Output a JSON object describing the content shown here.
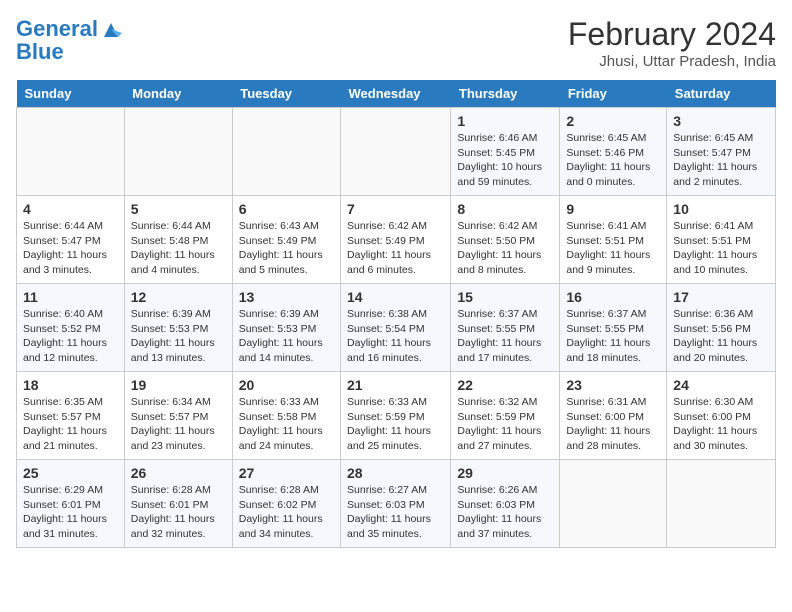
{
  "header": {
    "logo_line1": "General",
    "logo_line2": "Blue",
    "title": "February 2024",
    "subtitle": "Jhusi, Uttar Pradesh, India"
  },
  "weekdays": [
    "Sunday",
    "Monday",
    "Tuesday",
    "Wednesday",
    "Thursday",
    "Friday",
    "Saturday"
  ],
  "weeks": [
    [
      {
        "day": "",
        "info": ""
      },
      {
        "day": "",
        "info": ""
      },
      {
        "day": "",
        "info": ""
      },
      {
        "day": "",
        "info": ""
      },
      {
        "day": "1",
        "info": "Sunrise: 6:46 AM\nSunset: 5:45 PM\nDaylight: 10 hours and 59 minutes."
      },
      {
        "day": "2",
        "info": "Sunrise: 6:45 AM\nSunset: 5:46 PM\nDaylight: 11 hours and 0 minutes."
      },
      {
        "day": "3",
        "info": "Sunrise: 6:45 AM\nSunset: 5:47 PM\nDaylight: 11 hours and 2 minutes."
      }
    ],
    [
      {
        "day": "4",
        "info": "Sunrise: 6:44 AM\nSunset: 5:47 PM\nDaylight: 11 hours and 3 minutes."
      },
      {
        "day": "5",
        "info": "Sunrise: 6:44 AM\nSunset: 5:48 PM\nDaylight: 11 hours and 4 minutes."
      },
      {
        "day": "6",
        "info": "Sunrise: 6:43 AM\nSunset: 5:49 PM\nDaylight: 11 hours and 5 minutes."
      },
      {
        "day": "7",
        "info": "Sunrise: 6:42 AM\nSunset: 5:49 PM\nDaylight: 11 hours and 6 minutes."
      },
      {
        "day": "8",
        "info": "Sunrise: 6:42 AM\nSunset: 5:50 PM\nDaylight: 11 hours and 8 minutes."
      },
      {
        "day": "9",
        "info": "Sunrise: 6:41 AM\nSunset: 5:51 PM\nDaylight: 11 hours and 9 minutes."
      },
      {
        "day": "10",
        "info": "Sunrise: 6:41 AM\nSunset: 5:51 PM\nDaylight: 11 hours and 10 minutes."
      }
    ],
    [
      {
        "day": "11",
        "info": "Sunrise: 6:40 AM\nSunset: 5:52 PM\nDaylight: 11 hours and 12 minutes."
      },
      {
        "day": "12",
        "info": "Sunrise: 6:39 AM\nSunset: 5:53 PM\nDaylight: 11 hours and 13 minutes."
      },
      {
        "day": "13",
        "info": "Sunrise: 6:39 AM\nSunset: 5:53 PM\nDaylight: 11 hours and 14 minutes."
      },
      {
        "day": "14",
        "info": "Sunrise: 6:38 AM\nSunset: 5:54 PM\nDaylight: 11 hours and 16 minutes."
      },
      {
        "day": "15",
        "info": "Sunrise: 6:37 AM\nSunset: 5:55 PM\nDaylight: 11 hours and 17 minutes."
      },
      {
        "day": "16",
        "info": "Sunrise: 6:37 AM\nSunset: 5:55 PM\nDaylight: 11 hours and 18 minutes."
      },
      {
        "day": "17",
        "info": "Sunrise: 6:36 AM\nSunset: 5:56 PM\nDaylight: 11 hours and 20 minutes."
      }
    ],
    [
      {
        "day": "18",
        "info": "Sunrise: 6:35 AM\nSunset: 5:57 PM\nDaylight: 11 hours and 21 minutes."
      },
      {
        "day": "19",
        "info": "Sunrise: 6:34 AM\nSunset: 5:57 PM\nDaylight: 11 hours and 23 minutes."
      },
      {
        "day": "20",
        "info": "Sunrise: 6:33 AM\nSunset: 5:58 PM\nDaylight: 11 hours and 24 minutes."
      },
      {
        "day": "21",
        "info": "Sunrise: 6:33 AM\nSunset: 5:59 PM\nDaylight: 11 hours and 25 minutes."
      },
      {
        "day": "22",
        "info": "Sunrise: 6:32 AM\nSunset: 5:59 PM\nDaylight: 11 hours and 27 minutes."
      },
      {
        "day": "23",
        "info": "Sunrise: 6:31 AM\nSunset: 6:00 PM\nDaylight: 11 hours and 28 minutes."
      },
      {
        "day": "24",
        "info": "Sunrise: 6:30 AM\nSunset: 6:00 PM\nDaylight: 11 hours and 30 minutes."
      }
    ],
    [
      {
        "day": "25",
        "info": "Sunrise: 6:29 AM\nSunset: 6:01 PM\nDaylight: 11 hours and 31 minutes."
      },
      {
        "day": "26",
        "info": "Sunrise: 6:28 AM\nSunset: 6:01 PM\nDaylight: 11 hours and 32 minutes."
      },
      {
        "day": "27",
        "info": "Sunrise: 6:28 AM\nSunset: 6:02 PM\nDaylight: 11 hours and 34 minutes."
      },
      {
        "day": "28",
        "info": "Sunrise: 6:27 AM\nSunset: 6:03 PM\nDaylight: 11 hours and 35 minutes."
      },
      {
        "day": "29",
        "info": "Sunrise: 6:26 AM\nSunset: 6:03 PM\nDaylight: 11 hours and 37 minutes."
      },
      {
        "day": "",
        "info": ""
      },
      {
        "day": "",
        "info": ""
      }
    ]
  ]
}
